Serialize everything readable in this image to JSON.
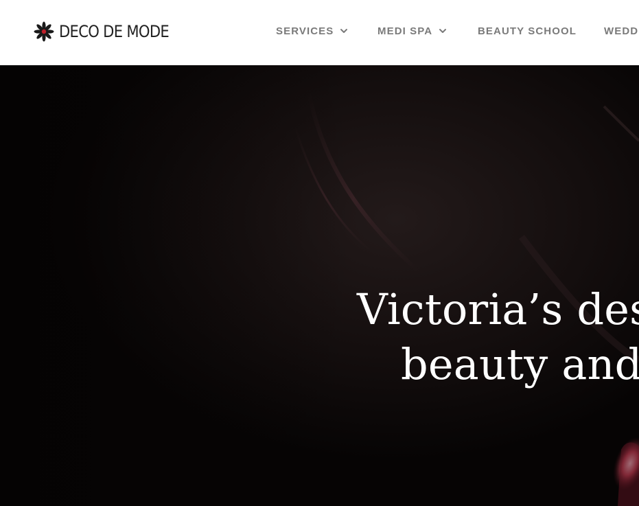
{
  "brand": {
    "name": "DECO DE MODE",
    "logo_icon": "flower-icon",
    "accent_color": "#c0202a"
  },
  "nav": {
    "items": [
      {
        "label": "SERVICES",
        "has_dropdown": true
      },
      {
        "label": "MEDI SPA",
        "has_dropdown": true
      },
      {
        "label": "BEAUTY SCHOOL",
        "has_dropdown": false
      },
      {
        "label": "WEDD",
        "has_dropdown": false
      }
    ]
  },
  "hero": {
    "title_line1": "Victoria’s des",
    "title_line2": "beauty and"
  }
}
